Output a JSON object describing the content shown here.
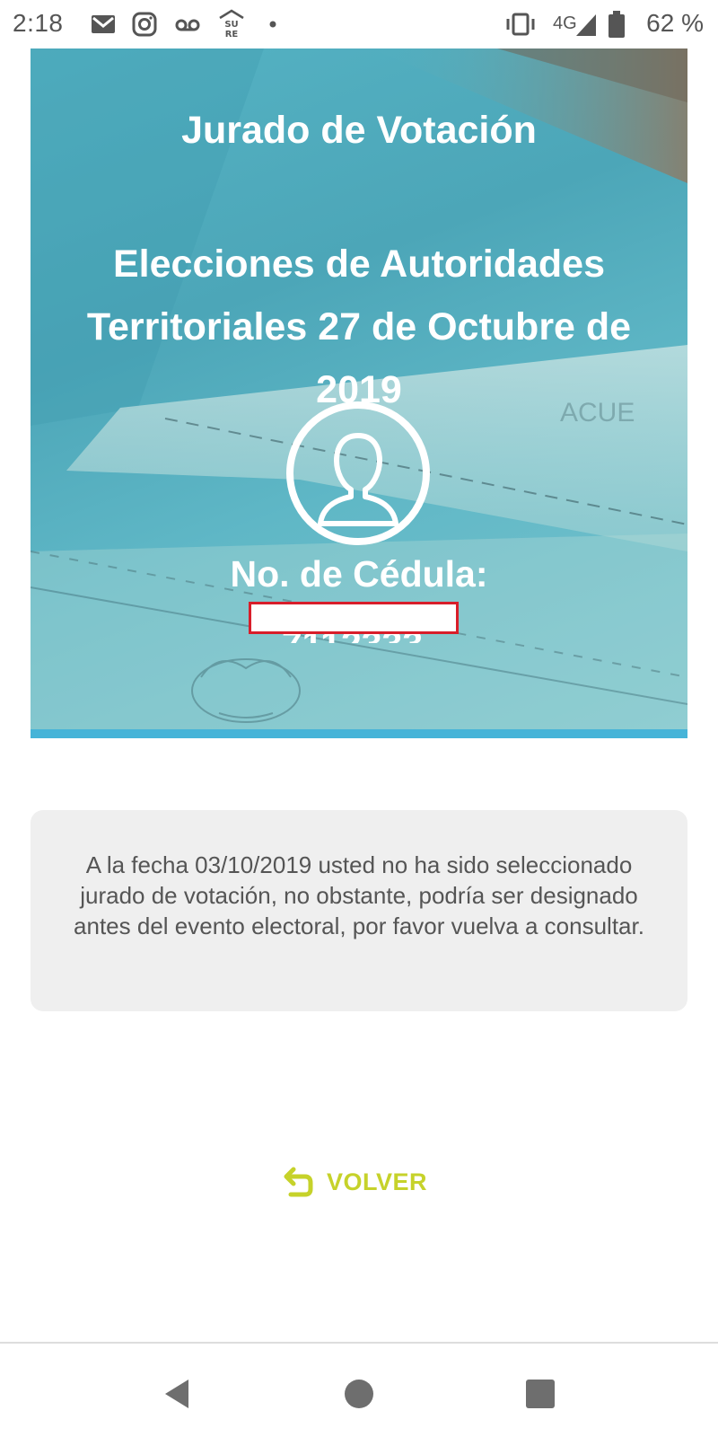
{
  "status_bar": {
    "time": "2:18",
    "network": "4G",
    "battery": "62 %",
    "icons": [
      "gmail-icon",
      "instagram-icon",
      "voicemail-icon",
      "sure-app-icon",
      "dot-icon",
      "vibrate-icon",
      "signal-icon",
      "battery-icon"
    ]
  },
  "hero": {
    "title": "Jurado de Votación",
    "subtitle": "Elecciones de Autoridades Territoriales 27 de Octubre de 2019",
    "cedula_label": "No. de Cédula:",
    "cedula_value": "7112333",
    "avatar_icon": "user-silhouette-icon"
  },
  "message": {
    "text": "A la fecha 03/10/2019 usted no ha sido seleccionado jurado de votación, no obstante, podría ser designado antes del evento electoral, por favor vuelva a consultar."
  },
  "back": {
    "label": "VOLVER",
    "icon": "undo-arrow-icon"
  },
  "nav_bar": {
    "buttons": [
      "back-triangle-icon",
      "home-circle-icon",
      "recents-square-icon"
    ]
  },
  "colors": {
    "accent": "#c6d22a",
    "hero_line": "#46b4d8",
    "redaction": "#d81e2a",
    "card_bg": "#efefef",
    "text_gray": "#555555"
  }
}
